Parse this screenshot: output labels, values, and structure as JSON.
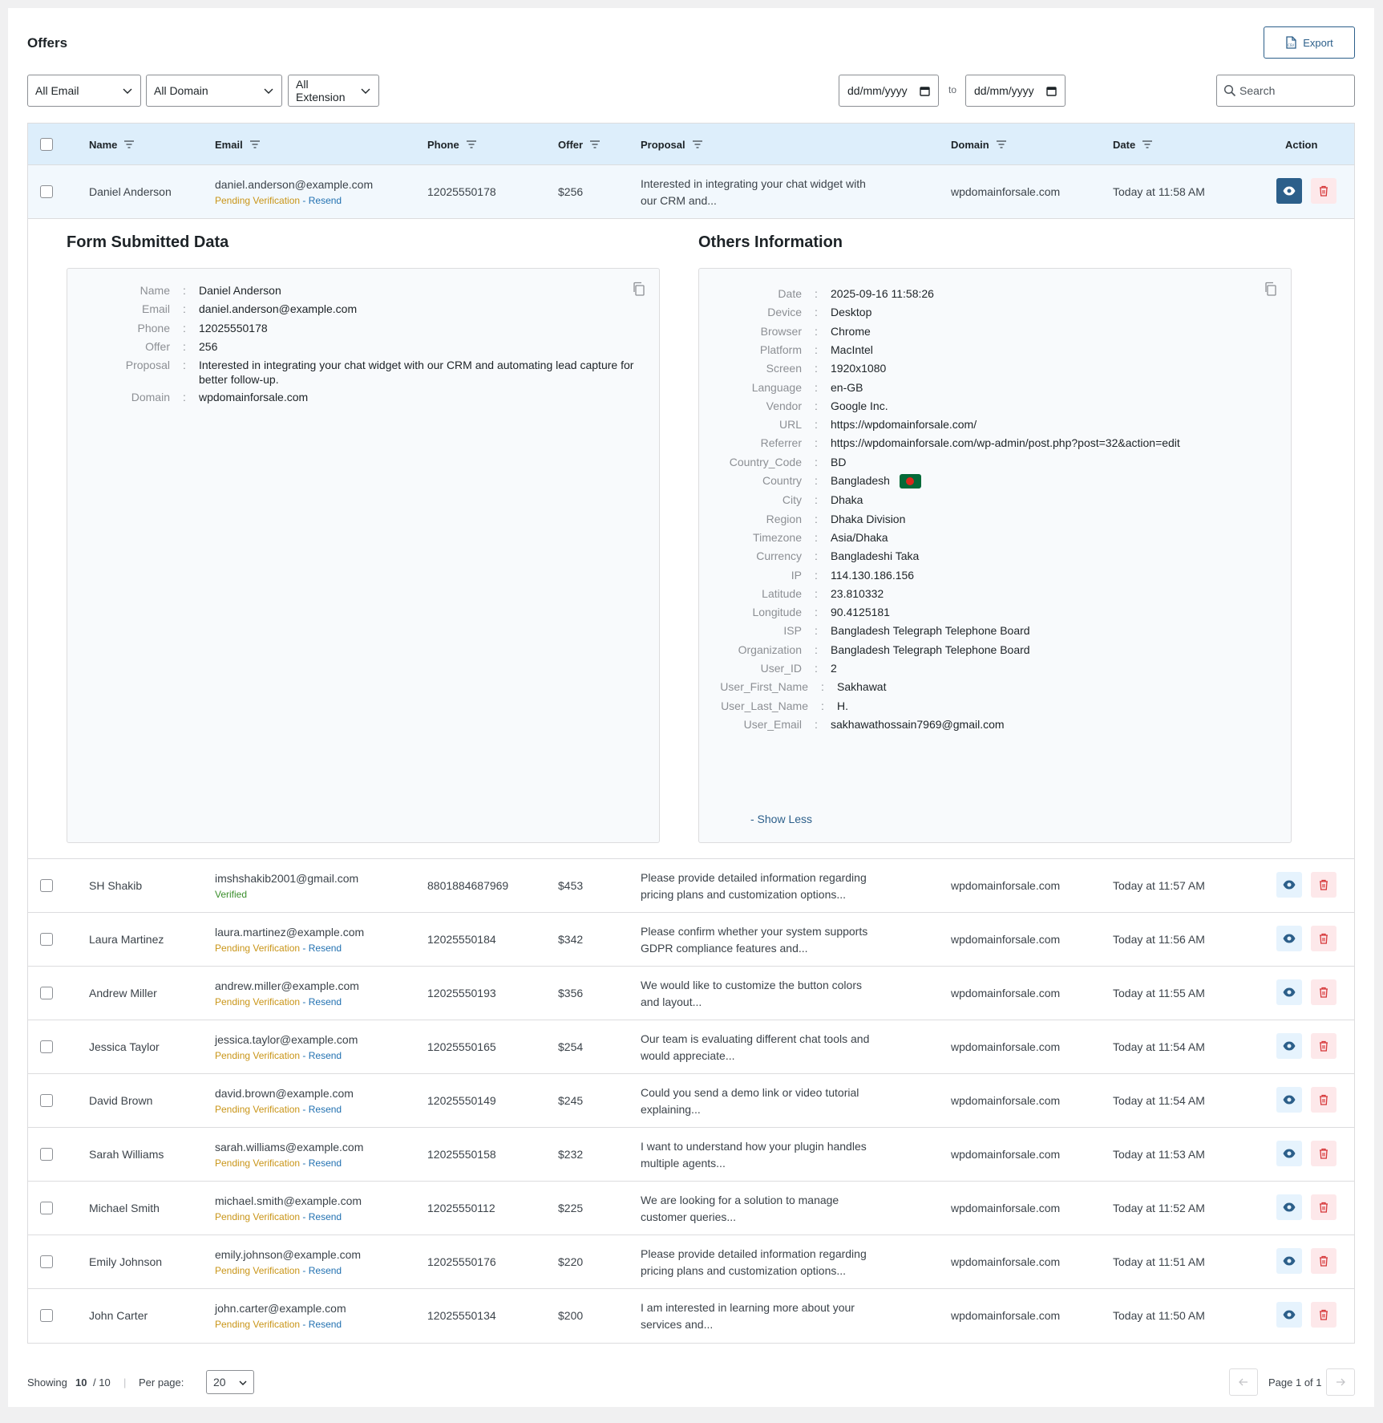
{
  "page": {
    "title": "Offers"
  },
  "toolbar": {
    "export_label": "Export"
  },
  "filters": {
    "email": "All Email",
    "domain": "All Domain",
    "extension": "All Extension",
    "date_from": "dd/mm/yyyy",
    "to_label": "to",
    "date_to": "dd/mm/yyyy",
    "search_placeholder": "Search"
  },
  "table": {
    "columns": [
      "Name",
      "Email",
      "Phone",
      "Offer",
      "Proposal",
      "Domain",
      "Date",
      "Action"
    ],
    "rows": [
      {
        "name": "Daniel Anderson",
        "email": "daniel.anderson@example.com",
        "status": "Pending Verification",
        "resend": " - Resend",
        "phone": "12025550178",
        "offer": "$256",
        "proposal_1": "Interested in integrating your chat widget with",
        "proposal_2": "our CRM and...",
        "domain": "wpdomainforsale.com",
        "date": "Today at 11:58 AM"
      },
      {
        "name": "SH Shakib",
        "email": "imshshakib2001@gmail.com",
        "status": "Verified",
        "resend": "",
        "phone": "8801884687969",
        "offer": "$453",
        "proposal_1": "Please provide detailed information regarding",
        "proposal_2": "pricing plans and customization options...",
        "domain": "wpdomainforsale.com",
        "date": "Today at 11:57 AM"
      },
      {
        "name": "Laura Martinez",
        "email": "laura.martinez@example.com",
        "status": "Pending Verification",
        "resend": " - Resend",
        "phone": "12025550184",
        "offer": "$342",
        "proposal_1": "Please confirm whether your system supports",
        "proposal_2": "GDPR compliance features and...",
        "domain": "wpdomainforsale.com",
        "date": "Today at 11:56 AM"
      },
      {
        "name": "Andrew Miller",
        "email": "andrew.miller@example.com",
        "status": "Pending Verification",
        "resend": " - Resend",
        "phone": "12025550193",
        "offer": "$356",
        "proposal_1": "We would like to customize the button colors",
        "proposal_2": "and layout...",
        "domain": "wpdomainforsale.com",
        "date": "Today at 11:55 AM"
      },
      {
        "name": "Jessica Taylor",
        "email": "jessica.taylor@example.com",
        "status": "Pending Verification",
        "resend": " - Resend",
        "phone": "12025550165",
        "offer": "$254",
        "proposal_1": "Our team is evaluating different chat tools and",
        "proposal_2": "would appreciate...",
        "domain": "wpdomainforsale.com",
        "date": "Today at 11:54 AM"
      },
      {
        "name": "David Brown",
        "email": "david.brown@example.com",
        "status": "Pending Verification",
        "resend": " - Resend",
        "phone": "12025550149",
        "offer": "$245",
        "proposal_1": "Could you send a demo link or video tutorial",
        "proposal_2": "explaining...",
        "domain": "wpdomainforsale.com",
        "date": "Today at 11:54 AM"
      },
      {
        "name": "Sarah Williams",
        "email": "sarah.williams@example.com",
        "status": "Pending Verification",
        "resend": " - Resend",
        "phone": "12025550158",
        "offer": "$232",
        "proposal_1": "I want to understand how your plugin handles",
        "proposal_2": "multiple agents...",
        "domain": "wpdomainforsale.com",
        "date": "Today at 11:53 AM"
      },
      {
        "name": "Michael Smith",
        "email": "michael.smith@example.com",
        "status": "Pending Verification",
        "resend": " - Resend",
        "phone": "12025550112",
        "offer": "$225",
        "proposal_1": "We are looking for a solution to manage",
        "proposal_2": "customer queries...",
        "domain": "wpdomainforsale.com",
        "date": "Today at 11:52 AM"
      },
      {
        "name": "Emily Johnson",
        "email": "emily.johnson@example.com",
        "status": "Pending Verification",
        "resend": " - Resend",
        "phone": "12025550176",
        "offer": "$220",
        "proposal_1": "Please provide detailed information regarding",
        "proposal_2": "pricing plans and customization options...",
        "domain": "wpdomainforsale.com",
        "date": "Today at 11:51 AM"
      },
      {
        "name": "John Carter",
        "email": "john.carter@example.com",
        "status": "Pending Verification",
        "resend": " - Resend",
        "phone": "12025550134",
        "offer": "$200",
        "proposal_1": "I am interested in learning more about your",
        "proposal_2": "services and...",
        "domain": "wpdomainforsale.com",
        "date": "Today at 11:50 AM"
      }
    ]
  },
  "detail": {
    "form_title": "Form Submitted Data",
    "others_title": "Others Information",
    "form_fields": [
      {
        "k": "Name",
        "v": "Daniel Anderson"
      },
      {
        "k": "Email",
        "v": "daniel.anderson@example.com"
      },
      {
        "k": "Phone",
        "v": "12025550178"
      },
      {
        "k": "Offer",
        "v": "256"
      },
      {
        "k": "Proposal",
        "v": "Interested in integrating your chat widget with our CRM and automating lead capture for better follow-up."
      },
      {
        "k": "Domain",
        "v": "wpdomainforsale.com"
      }
    ],
    "others_fields": [
      {
        "k": "Date",
        "v": "2025-09-16 11:58:26"
      },
      {
        "k": "Device",
        "v": "Desktop"
      },
      {
        "k": "Browser",
        "v": "Chrome"
      },
      {
        "k": "Platform",
        "v": "MacIntel"
      },
      {
        "k": "Screen",
        "v": "1920x1080"
      },
      {
        "k": "Language",
        "v": "en-GB"
      },
      {
        "k": "Vendor",
        "v": "Google Inc."
      },
      {
        "k": "URL",
        "v": "https://wpdomainforsale.com/"
      },
      {
        "k": "Referrer",
        "v": "https://wpdomainforsale.com/wp-admin/post.php?post=32&action=edit"
      },
      {
        "k": "Country_Code",
        "v": "BD"
      },
      {
        "k": "Country",
        "v": "Bangladesh"
      },
      {
        "k": "City",
        "v": "Dhaka"
      },
      {
        "k": "Region",
        "v": "Dhaka Division"
      },
      {
        "k": "Timezone",
        "v": "Asia/Dhaka"
      },
      {
        "k": "Currency",
        "v": "Bangladeshi Taka"
      },
      {
        "k": "IP",
        "v": "114.130.186.156"
      },
      {
        "k": "Latitude",
        "v": "23.810332"
      },
      {
        "k": "Longitude",
        "v": "90.4125181"
      },
      {
        "k": "ISP",
        "v": "Bangladesh Telegraph Telephone Board"
      },
      {
        "k": "Organization",
        "v": "Bangladesh Telegraph Telephone Board"
      },
      {
        "k": "User_ID",
        "v": "2"
      },
      {
        "k": "User_First_Name",
        "v": "Sakhawat"
      },
      {
        "k": "User_Last_Name",
        "v": "H."
      },
      {
        "k": "User_Email",
        "v": "sakhawathossain7969@gmail.com"
      }
    ],
    "show_less_label": "- Show Less"
  },
  "footer": {
    "showing_label": "Showing",
    "showing_count": "10",
    "showing_total": "/ 10",
    "separator": "|",
    "per_page_label": "Per page:",
    "per_page_value": "20",
    "page_info": "Page 1 of 1"
  },
  "colors": {
    "accent": "#2c5f8a",
    "header_bg": "#ddeefb",
    "pending": "#c99518",
    "verified": "#3b8f2c",
    "link": "#2271b1",
    "danger": "#d63638"
  }
}
